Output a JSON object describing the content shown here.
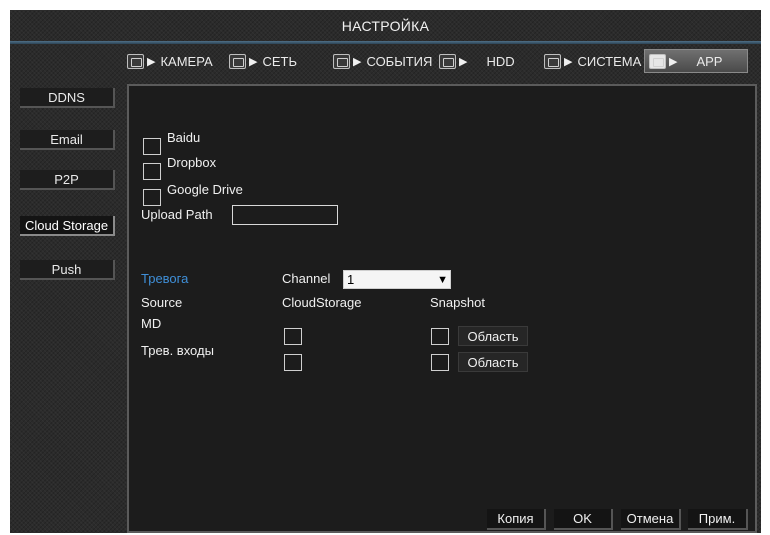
{
  "window": {
    "title": "НАСТРОЙКА"
  },
  "tabs": [
    {
      "label": "КАМЕРА",
      "icon": "camera-icon"
    },
    {
      "label": "СЕТЬ",
      "icon": "network-icon"
    },
    {
      "label": "СОБЫТИЯ",
      "icon": "alarm-icon"
    },
    {
      "label": "HDD",
      "icon": "hdd-icon"
    },
    {
      "label": "СИСТЕМА",
      "icon": "system-icon"
    },
    {
      "label": "APP",
      "icon": "app-icon",
      "active": true
    }
  ],
  "sidebar": {
    "items": [
      {
        "label": "DDNS"
      },
      {
        "label": "Email"
      },
      {
        "label": "P2P"
      },
      {
        "label": "Cloud Storage",
        "active": true
      },
      {
        "label": "Push"
      }
    ]
  },
  "cloud": {
    "services": [
      {
        "label": "Baidu",
        "checked": false
      },
      {
        "label": "Dropbox",
        "checked": false
      },
      {
        "label": "Google Drive",
        "checked": false
      }
    ],
    "upload_path_label": "Upload Path",
    "upload_path_value": ""
  },
  "alarm": {
    "section_label": "Тревога",
    "channel_label": "Channel",
    "channel_value": "1",
    "col_source": "Source",
    "col_cloud": "CloudStorage",
    "col_snapshot": "Snapshot",
    "rows": [
      {
        "source": "MD",
        "area_button": "Область"
      },
      {
        "source": "Трев. входы",
        "area_button": "Область"
      }
    ]
  },
  "buttons": {
    "copy": "Копия",
    "ok": "OK",
    "cancel": "Отмена",
    "apply": "Прим."
  },
  "colors": {
    "accent": "#3f8fd8",
    "title_line": "#3e5a70"
  }
}
